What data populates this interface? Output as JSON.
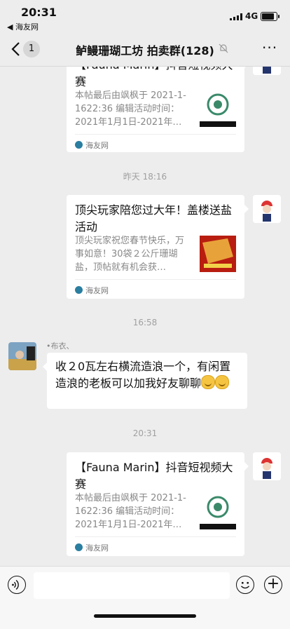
{
  "status_bar": {
    "time": "20:31",
    "back_app": "◀ 海友网",
    "network": "4G",
    "battery_level": 0.85
  },
  "nav": {
    "unread_count": "1",
    "title": "鲈鳗珊瑚工坊 拍卖群(128)",
    "more_label": "···"
  },
  "messages": [
    {
      "type": "card",
      "title": "【Fauna Marin】抖音短视频大赛",
      "desc": "本帖最后由飒枫于 2021-1-1622:36 编辑活动时间：2021年1月1日-2021年…",
      "source": "海友网"
    },
    {
      "type": "time",
      "text": "昨天 18:16"
    },
    {
      "type": "card",
      "title": "顶尖玩家陪您过大年！盖楼送盐活动",
      "desc": "顶尖玩家祝您春节快乐，万事如意！30袋２公斤珊瑚盐，顶帖就有机会获…",
      "source": "海友网"
    },
    {
      "type": "time",
      "text": "16:58"
    },
    {
      "type": "text",
      "sender": "•布衣、",
      "text": "收２0瓦左右横流造浪一个，有闲置造浪的老板可以加我好友聊聊"
    },
    {
      "type": "time",
      "text": "20:31"
    },
    {
      "type": "card",
      "title": "【Fauna Marin】抖音短视频大赛",
      "desc": "本帖最后由飒枫于 2021-1-1622:36 编辑活动时间：2021年1月1日-2021年…",
      "source": "海友网"
    }
  ],
  "colors": {
    "background": "#ededed",
    "bubble": "#ffffff",
    "source_icon": "#2a7ea0"
  }
}
